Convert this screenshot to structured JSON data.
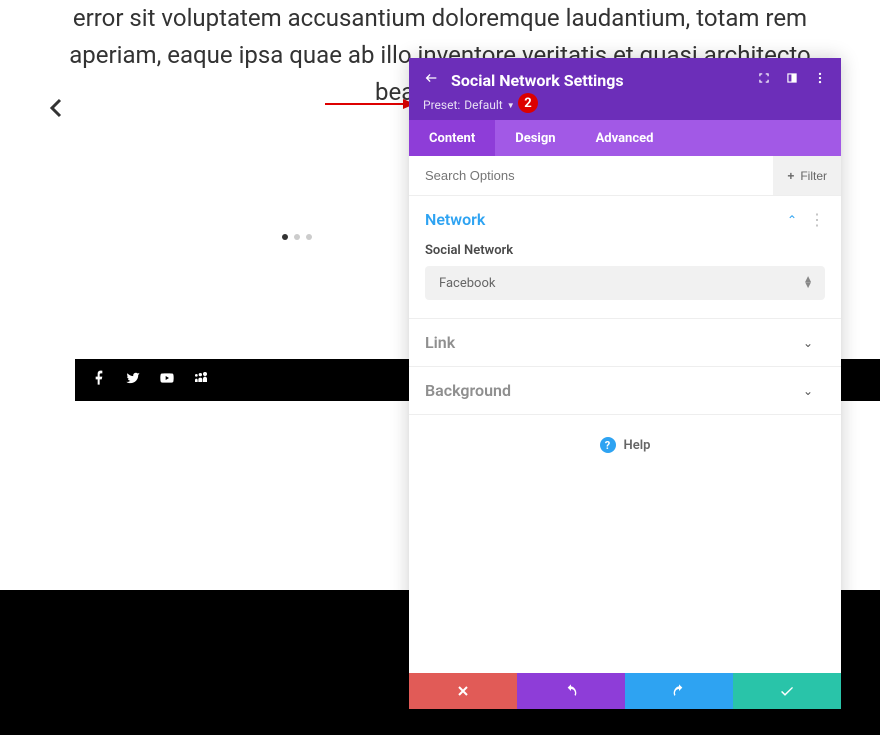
{
  "background": {
    "paragraph": "error sit voluptatem accusantium doloremque laudantium, totam rem aperiam, eaque ipsa quae ab illo inventore veritatis et quasi architecto beatae vitae"
  },
  "slider": {
    "active_index": 0,
    "dot_count": 3
  },
  "social_icons": [
    "facebook",
    "twitter",
    "youtube",
    "myspace"
  ],
  "annotation": {
    "number": "2"
  },
  "panel": {
    "title": "Social Network Settings",
    "preset_label": "Preset:",
    "preset_value": "Default",
    "tabs": {
      "content": "Content",
      "design": "Design",
      "advanced": "Advanced",
      "active": "content"
    },
    "search_placeholder": "Search Options",
    "filter_label": "Filter",
    "sections": {
      "network": {
        "title": "Network",
        "open": true,
        "field_label": "Social Network",
        "select_value": "Facebook"
      },
      "link": {
        "title": "Link",
        "open": false
      },
      "background_sec": {
        "title": "Background",
        "open": false
      }
    },
    "help_label": "Help"
  }
}
